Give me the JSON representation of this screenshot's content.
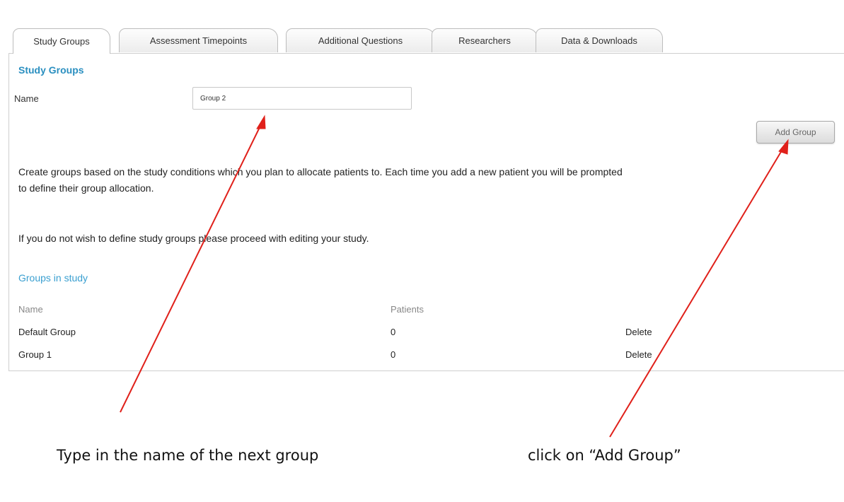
{
  "tabs": [
    {
      "label": "Study Groups",
      "active": true
    },
    {
      "label": "Assessment Timepoints",
      "active": false
    },
    {
      "label": "Additional Questions",
      "active": false
    },
    {
      "label": "Researchers",
      "active": false
    },
    {
      "label": "Data & Downloads",
      "active": false
    }
  ],
  "form": {
    "section_title": "Study Groups",
    "name_label": "Name",
    "name_value": "Group 2",
    "add_button_label": "Add Group"
  },
  "info": {
    "line1": "Create groups based on the study conditions which you plan to allocate patients to. Each time you add a new patient you will be prompted",
    "line2": "to define their group allocation.",
    "line3": "If you do not wish to define study groups please proceed with editing your study."
  },
  "groups": {
    "title": "Groups in study",
    "columns": [
      "Name",
      "Patients"
    ],
    "rows": [
      {
        "name": "Default Group",
        "patients": "0",
        "action": "Delete"
      },
      {
        "name": "Group 1",
        "patients": "0",
        "action": "Delete"
      }
    ]
  },
  "annotations": {
    "left_caption": "Type in the name of the next group",
    "right_caption": "click on “Add Group”",
    "arrow_color": "#e0201a"
  }
}
